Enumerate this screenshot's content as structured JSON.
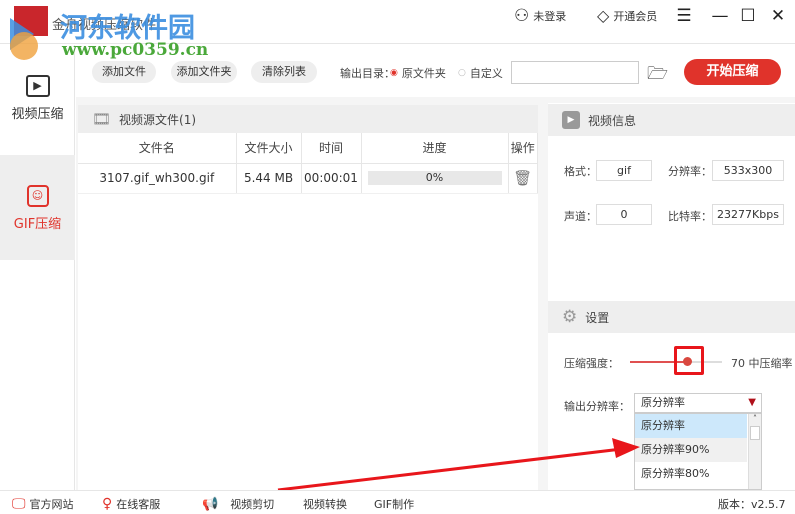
{
  "app": {
    "title": "金舟视频压缩软件",
    "watermark_name": "河东软件园",
    "watermark_url": "www.pc0359.cn"
  },
  "topbar": {
    "login": "未登录",
    "vip": "开通会员",
    "icons": [
      "user-icon",
      "diamond-icon",
      "menu-icon",
      "maximize-icon",
      "close-icon"
    ]
  },
  "sidebar": {
    "items": [
      {
        "label": "视频压缩",
        "icon": "video-play-icon",
        "active": false
      },
      {
        "label": "GIF压缩",
        "icon": "gif-image-icon",
        "active": true
      }
    ]
  },
  "toolbar": {
    "add_file": "添加文件",
    "add_folder": "添加文件夹",
    "clear_list": "清除列表",
    "output_dir_label": "输出目录：",
    "opt_source": "原文件夹",
    "opt_custom": "自定义",
    "path_value": "",
    "start": "开始压缩"
  },
  "files": {
    "header": "视频源文件(1)",
    "columns": [
      "文件名",
      "文件大小",
      "时间",
      "进度",
      "操作"
    ],
    "rows": [
      {
        "name": "3107.gif_wh300.gif",
        "size": "5.44 MB",
        "time": "00:00:01",
        "progress": "0%",
        "progress_value": 0
      }
    ]
  },
  "video_info": {
    "header": "视频信息",
    "format_label": "格式：",
    "format": "gif",
    "resolution_label": "分辨率：",
    "resolution": "533x300",
    "channel_label": "声道：",
    "channel": "0",
    "bitrate_label": "比特率：",
    "bitrate": "23277Kbps"
  },
  "settings": {
    "header": "设置",
    "strength_label": "压缩强度：",
    "strength_value": 70,
    "strength_text": "70 中压缩率",
    "res_label": "输出分辨率：",
    "res_selected": "原分辨率",
    "res_options": [
      "原分辨率",
      "原分辨率90%",
      "原分辨率80%"
    ]
  },
  "footer": {
    "website": "官方网站",
    "support": "在线客服",
    "cut": "视频剪切",
    "convert": "视频转换",
    "gif": "GIF制作",
    "version": "版本：v2.5.7"
  },
  "colors": {
    "accent": "#e0332b",
    "highlight": "#cde8fb"
  }
}
